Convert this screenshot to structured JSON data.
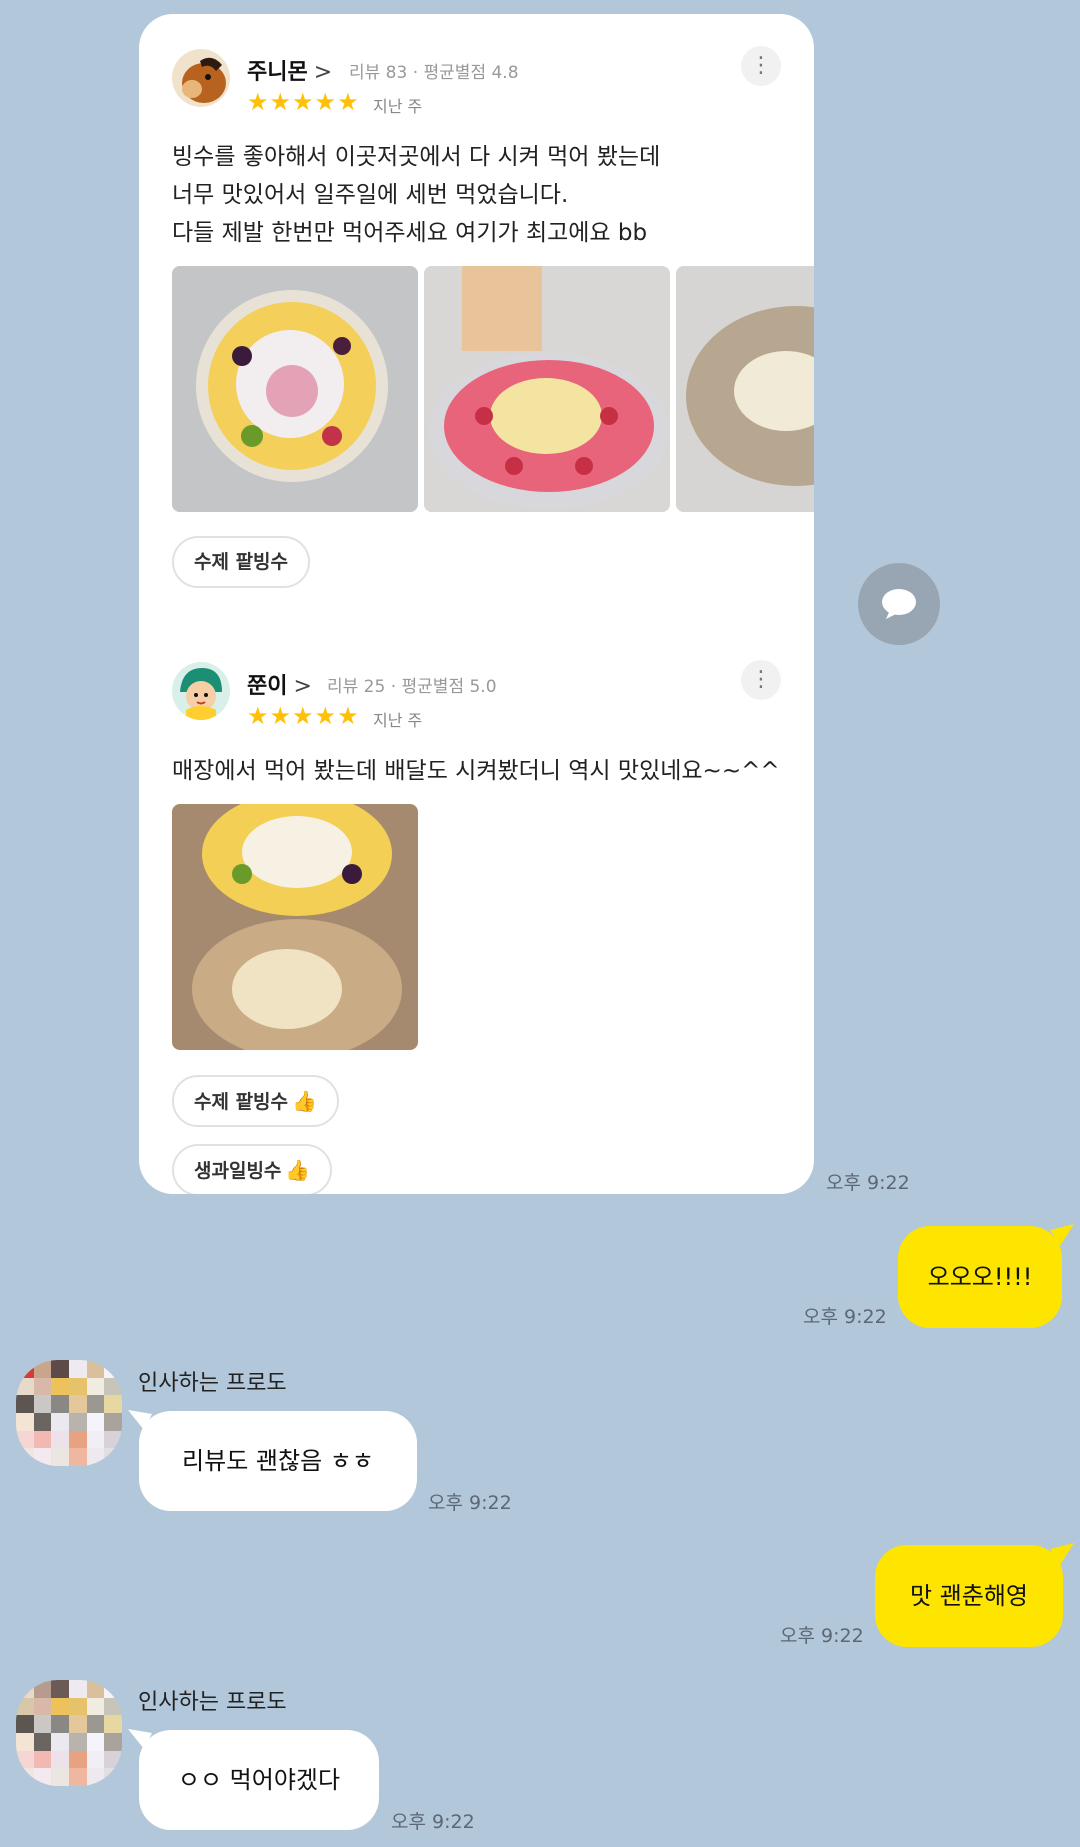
{
  "review_card": {
    "reviews": [
      {
        "name": "주니몬",
        "chevron": ">",
        "meta": "리뷰 83 · 평균별점 4.8",
        "stars": "★★★★★",
        "ago": "지난 주",
        "more": "⋮",
        "text": "빙수를 좋아해서 이곳저곳에서 다 시켜 먹어 봤는데\n너무 맛있어서 일주일에 세번 먹었습니다.\n다들 제발 한번만 먹어주세요 여기가 최고에요 bb",
        "tags": [
          {
            "label": "수제 팥빙수",
            "thumb": ""
          }
        ]
      },
      {
        "name": "쭌이",
        "chevron": ">",
        "meta": "리뷰 25 · 평균별점 5.0",
        "stars": "★★★★★",
        "ago": "지난 주",
        "more": "⋮",
        "text": "매장에서 먹어 봤는데 배달도 시켜봤더니 역시 맛있네요~~^^",
        "tags": [
          {
            "label": "수제 팥빙수",
            "thumb": "👍"
          },
          {
            "label": "생과일빙수",
            "thumb": "👍"
          }
        ]
      }
    ],
    "time": "오후 9:22"
  },
  "chat": {
    "messages": [
      {
        "from": "me",
        "text": "오오오!!!!",
        "time": "오후 9:22"
      },
      {
        "from": "other",
        "sender": "인사하는 프로도",
        "text": "리뷰도 괜찮음 ㅎㅎ",
        "time": "오후 9:22"
      },
      {
        "from": "me",
        "text": "맛 괜춘해영",
        "time": "오후 9:22"
      },
      {
        "from": "other",
        "sender": "인사하는 프로도",
        "text": "ㅇㅇ 먹어야겠다",
        "time": "오후 9:22"
      }
    ],
    "share_icon": "speech-bubble-icon"
  },
  "colors": {
    "background": "#b2c7d9",
    "my_bubble": "#fee500",
    "other_bubble": "#ffffff",
    "star": "#ffc107",
    "thumb_accent": "#17b98f"
  }
}
